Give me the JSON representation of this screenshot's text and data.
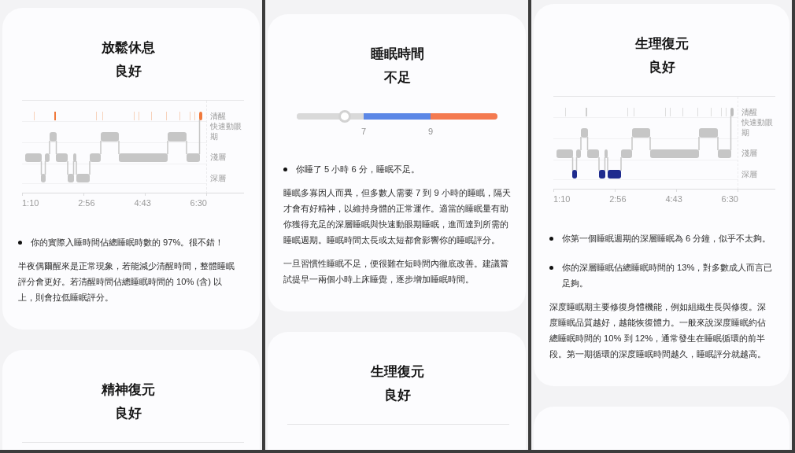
{
  "panels": [
    {
      "cards": [
        {
          "kind": "hypnogram",
          "title": "放鬆休息",
          "rating": "良好",
          "hypnogram": {
            "stages": [
              {
                "label": "清醒",
                "highlighted": true
              },
              {
                "label": "快速動眼期",
                "highlighted": false
              },
              {
                "label": "淺層",
                "highlighted": false
              },
              {
                "label": "深層",
                "highlighted": false
              }
            ],
            "time_labels": [
              "1:10",
              "2:56",
              "4:43",
              "6:30"
            ]
          },
          "bullets": [
            "你的實際入睡時間佔總睡眠時數的 97%。很不錯！"
          ],
          "paragraphs": [
            "半夜偶爾醒來是正常現象，若能減少清醒時間，整體睡眠評分會更好。若清醒時間佔總睡眠時間的 10% (含) 以上，則會拉低睡眠評分。"
          ]
        },
        {
          "kind": "hypnogram",
          "title": "精神復元",
          "rating": "良好"
        }
      ]
    },
    {
      "cards": [
        {
          "kind": "slider",
          "title": "睡眠時間",
          "rating": "不足",
          "slider": {
            "level": 0.24,
            "zones": [
              {
                "color": "#d9d9d9"
              },
              {
                "color": "#5b87e6",
                "label": "7"
              },
              {
                "color": "#f47a50",
                "label": "9"
              }
            ]
          },
          "bullets": [
            "你睡了 5 小時 6 分，睡眠不足。"
          ],
          "paragraphs": [
            "睡眠多寡因人而異，但多數人需要 7 到 9 小時的睡眠，隔天才會有好精神，以維持身體的正常運作。適當的睡眠量有助你獲得充足的深層睡眠與快速動眼期睡眠，進而達到所需的睡眠週期。睡眠時間太長或太短都會影響你的睡眠評分。",
            "一旦習慣性睡眠不足，便很難在短時間內徹底改善。建議嘗試提早一兩個小時上床睡覺，逐步增加睡眠時間。"
          ]
        },
        {
          "kind": "hypnogram",
          "title": "生理復元",
          "rating": "良好"
        }
      ]
    },
    {
      "cards": [
        {
          "kind": "hypnogram",
          "title": "生理復元",
          "rating": "良好",
          "hypnogram": {
            "stages": [
              {
                "label": "清醒",
                "highlighted": false
              },
              {
                "label": "快速動眼期",
                "highlighted": false
              },
              {
                "label": "淺層",
                "highlighted": false
              },
              {
                "label": "深層",
                "highlighted": true
              }
            ],
            "time_labels": [
              "1:10",
              "2:56",
              "4:43",
              "6:30"
            ]
          },
          "bullets": [
            "你第一個睡眠週期的深層睡眠為 6 分鐘，似乎不太夠。",
            "你的深層睡眠佔總睡眠時間的 13%，對多數成人而言已足夠。"
          ],
          "paragraphs": [
            "深度睡眠期主要修復身體機能，例如組織生長與修復。深度睡眠品質越好，越能恢復體力。一般來說深度睡眠約佔總睡眠時間的 10% 到 12%，通常發生在睡眠循環的前半段。第一期循環的深度睡眠時間越久，睡眠評分就越高。"
          ]
        },
        {
          "kind": "empty"
        }
      ]
    }
  ]
}
